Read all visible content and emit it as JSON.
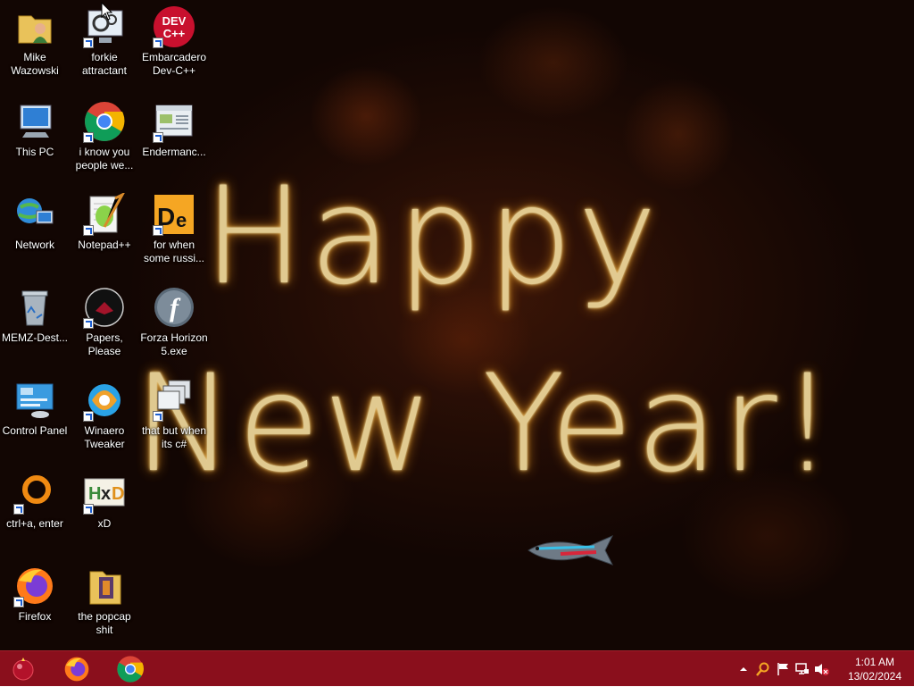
{
  "desktop": {
    "greeting_line1": "Happy",
    "greeting_line2": "New Year!",
    "icons": [
      {
        "label": "Mike Wazowski",
        "icon": "folder-user-icon"
      },
      {
        "label": "forkie attractant",
        "icon": "settings-monitor-icon"
      },
      {
        "label": "Embarcadero Dev-C++",
        "icon": "devcpp-icon"
      },
      {
        "label": "This PC",
        "icon": "computer-icon"
      },
      {
        "label": "i know you people we...",
        "icon": "chrome-icon"
      },
      {
        "label": "Endermanc...",
        "icon": "window-app-icon"
      },
      {
        "label": "Network",
        "icon": "network-icon"
      },
      {
        "label": "Notepad++",
        "icon": "notepadpp-icon"
      },
      {
        "label": "for when some russi...",
        "icon": "de-app-icon"
      },
      {
        "label": "MEMZ-Dest...",
        "icon": "recycle-bin-icon"
      },
      {
        "label": "Papers, Please",
        "icon": "papers-please-icon"
      },
      {
        "label": "Forza Horizon 5.exe",
        "icon": "flash-icon"
      },
      {
        "label": "Control Panel",
        "icon": "control-panel-icon"
      },
      {
        "label": "Winaero Tweaker",
        "icon": "winaero-icon"
      },
      {
        "label": "that but when its c#",
        "icon": "windows-stack-icon"
      },
      {
        "label": "ctrl+a, enter",
        "icon": "ring-app-icon"
      },
      {
        "label": "xD",
        "icon": "hxd-icon"
      },
      {
        "label": "Firefox",
        "icon": "firefox-icon"
      },
      {
        "label": "the popcap shit",
        "icon": "folder-icon"
      }
    ]
  },
  "taskbar": {
    "pinned": [
      "start-orb-icon",
      "firefox-icon",
      "chrome-icon"
    ],
    "tray": [
      "chevron-up-icon",
      "search-tray-icon",
      "flag-icon",
      "network-tray-icon",
      "volume-muted-icon"
    ],
    "clock_time": "1:01 AM",
    "clock_date": "13/02/2024"
  },
  "colors": {
    "taskbar": "#8a0f1c",
    "background": "#220c05",
    "lights": "#ffc14a"
  }
}
